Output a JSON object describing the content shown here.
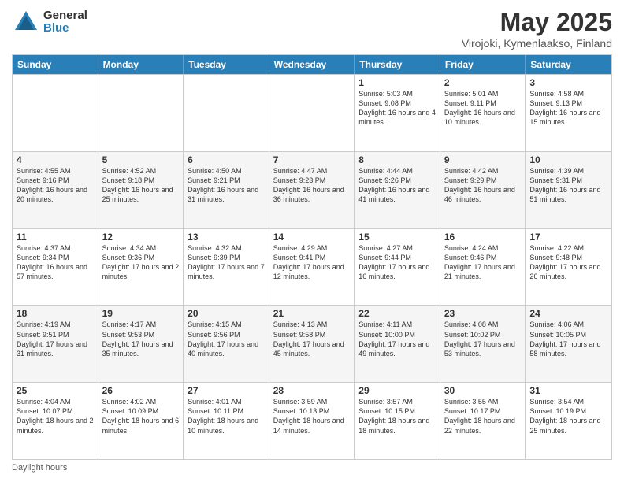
{
  "header": {
    "logo_general": "General",
    "logo_blue": "Blue",
    "month_title": "May 2025",
    "location": "Virojoki, Kymenlaakso, Finland"
  },
  "days_of_week": [
    "Sunday",
    "Monday",
    "Tuesday",
    "Wednesday",
    "Thursday",
    "Friday",
    "Saturday"
  ],
  "footer_text": "Daylight hours",
  "weeks": [
    [
      {
        "day": "",
        "sunrise": "",
        "sunset": "",
        "daylight": ""
      },
      {
        "day": "",
        "sunrise": "",
        "sunset": "",
        "daylight": ""
      },
      {
        "day": "",
        "sunrise": "",
        "sunset": "",
        "daylight": ""
      },
      {
        "day": "",
        "sunrise": "",
        "sunset": "",
        "daylight": ""
      },
      {
        "day": "1",
        "sunrise": "Sunrise: 5:03 AM",
        "sunset": "Sunset: 9:08 PM",
        "daylight": "Daylight: 16 hours and 4 minutes."
      },
      {
        "day": "2",
        "sunrise": "Sunrise: 5:01 AM",
        "sunset": "Sunset: 9:11 PM",
        "daylight": "Daylight: 16 hours and 10 minutes."
      },
      {
        "day": "3",
        "sunrise": "Sunrise: 4:58 AM",
        "sunset": "Sunset: 9:13 PM",
        "daylight": "Daylight: 16 hours and 15 minutes."
      }
    ],
    [
      {
        "day": "4",
        "sunrise": "Sunrise: 4:55 AM",
        "sunset": "Sunset: 9:16 PM",
        "daylight": "Daylight: 16 hours and 20 minutes."
      },
      {
        "day": "5",
        "sunrise": "Sunrise: 4:52 AM",
        "sunset": "Sunset: 9:18 PM",
        "daylight": "Daylight: 16 hours and 25 minutes."
      },
      {
        "day": "6",
        "sunrise": "Sunrise: 4:50 AM",
        "sunset": "Sunset: 9:21 PM",
        "daylight": "Daylight: 16 hours and 31 minutes."
      },
      {
        "day": "7",
        "sunrise": "Sunrise: 4:47 AM",
        "sunset": "Sunset: 9:23 PM",
        "daylight": "Daylight: 16 hours and 36 minutes."
      },
      {
        "day": "8",
        "sunrise": "Sunrise: 4:44 AM",
        "sunset": "Sunset: 9:26 PM",
        "daylight": "Daylight: 16 hours and 41 minutes."
      },
      {
        "day": "9",
        "sunrise": "Sunrise: 4:42 AM",
        "sunset": "Sunset: 9:29 PM",
        "daylight": "Daylight: 16 hours and 46 minutes."
      },
      {
        "day": "10",
        "sunrise": "Sunrise: 4:39 AM",
        "sunset": "Sunset: 9:31 PM",
        "daylight": "Daylight: 16 hours and 51 minutes."
      }
    ],
    [
      {
        "day": "11",
        "sunrise": "Sunrise: 4:37 AM",
        "sunset": "Sunset: 9:34 PM",
        "daylight": "Daylight: 16 hours and 57 minutes."
      },
      {
        "day": "12",
        "sunrise": "Sunrise: 4:34 AM",
        "sunset": "Sunset: 9:36 PM",
        "daylight": "Daylight: 17 hours and 2 minutes."
      },
      {
        "day": "13",
        "sunrise": "Sunrise: 4:32 AM",
        "sunset": "Sunset: 9:39 PM",
        "daylight": "Daylight: 17 hours and 7 minutes."
      },
      {
        "day": "14",
        "sunrise": "Sunrise: 4:29 AM",
        "sunset": "Sunset: 9:41 PM",
        "daylight": "Daylight: 17 hours and 12 minutes."
      },
      {
        "day": "15",
        "sunrise": "Sunrise: 4:27 AM",
        "sunset": "Sunset: 9:44 PM",
        "daylight": "Daylight: 17 hours and 16 minutes."
      },
      {
        "day": "16",
        "sunrise": "Sunrise: 4:24 AM",
        "sunset": "Sunset: 9:46 PM",
        "daylight": "Daylight: 17 hours and 21 minutes."
      },
      {
        "day": "17",
        "sunrise": "Sunrise: 4:22 AM",
        "sunset": "Sunset: 9:48 PM",
        "daylight": "Daylight: 17 hours and 26 minutes."
      }
    ],
    [
      {
        "day": "18",
        "sunrise": "Sunrise: 4:19 AM",
        "sunset": "Sunset: 9:51 PM",
        "daylight": "Daylight: 17 hours and 31 minutes."
      },
      {
        "day": "19",
        "sunrise": "Sunrise: 4:17 AM",
        "sunset": "Sunset: 9:53 PM",
        "daylight": "Daylight: 17 hours and 35 minutes."
      },
      {
        "day": "20",
        "sunrise": "Sunrise: 4:15 AM",
        "sunset": "Sunset: 9:56 PM",
        "daylight": "Daylight: 17 hours and 40 minutes."
      },
      {
        "day": "21",
        "sunrise": "Sunrise: 4:13 AM",
        "sunset": "Sunset: 9:58 PM",
        "daylight": "Daylight: 17 hours and 45 minutes."
      },
      {
        "day": "22",
        "sunrise": "Sunrise: 4:11 AM",
        "sunset": "Sunset: 10:00 PM",
        "daylight": "Daylight: 17 hours and 49 minutes."
      },
      {
        "day": "23",
        "sunrise": "Sunrise: 4:08 AM",
        "sunset": "Sunset: 10:02 PM",
        "daylight": "Daylight: 17 hours and 53 minutes."
      },
      {
        "day": "24",
        "sunrise": "Sunrise: 4:06 AM",
        "sunset": "Sunset: 10:05 PM",
        "daylight": "Daylight: 17 hours and 58 minutes."
      }
    ],
    [
      {
        "day": "25",
        "sunrise": "Sunrise: 4:04 AM",
        "sunset": "Sunset: 10:07 PM",
        "daylight": "Daylight: 18 hours and 2 minutes."
      },
      {
        "day": "26",
        "sunrise": "Sunrise: 4:02 AM",
        "sunset": "Sunset: 10:09 PM",
        "daylight": "Daylight: 18 hours and 6 minutes."
      },
      {
        "day": "27",
        "sunrise": "Sunrise: 4:01 AM",
        "sunset": "Sunset: 10:11 PM",
        "daylight": "Daylight: 18 hours and 10 minutes."
      },
      {
        "day": "28",
        "sunrise": "Sunrise: 3:59 AM",
        "sunset": "Sunset: 10:13 PM",
        "daylight": "Daylight: 18 hours and 14 minutes."
      },
      {
        "day": "29",
        "sunrise": "Sunrise: 3:57 AM",
        "sunset": "Sunset: 10:15 PM",
        "daylight": "Daylight: 18 hours and 18 minutes."
      },
      {
        "day": "30",
        "sunrise": "Sunrise: 3:55 AM",
        "sunset": "Sunset: 10:17 PM",
        "daylight": "Daylight: 18 hours and 22 minutes."
      },
      {
        "day": "31",
        "sunrise": "Sunrise: 3:54 AM",
        "sunset": "Sunset: 10:19 PM",
        "daylight": "Daylight: 18 hours and 25 minutes."
      }
    ]
  ]
}
